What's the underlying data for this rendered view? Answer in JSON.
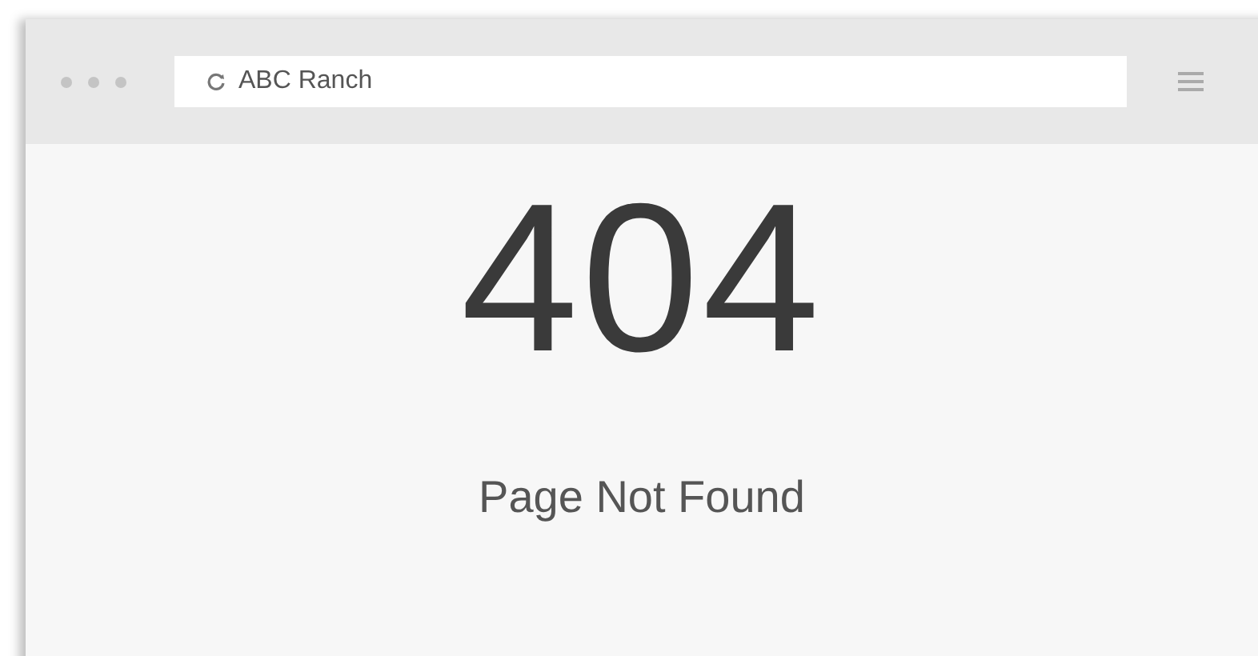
{
  "address_bar": {
    "value": "ABC Ranch"
  },
  "error": {
    "code": "404",
    "message": "Page Not Found"
  }
}
